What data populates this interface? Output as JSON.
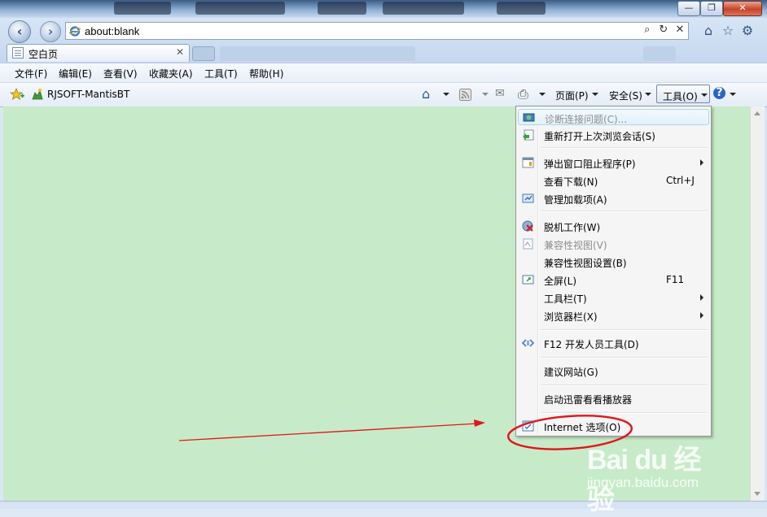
{
  "window": {
    "caption_buttons": [
      "—",
      "❐",
      "✕"
    ]
  },
  "address_bar": {
    "url": "about:blank",
    "search_glyph": "⌕",
    "refresh_glyph": "↻",
    "stop_glyph": "✕"
  },
  "tab": {
    "title": "空白页",
    "close_glyph": "✕"
  },
  "menubar": {
    "items": [
      "文件(F)",
      "编辑(E)",
      "查看(V)",
      "收藏夹(A)",
      "工具(T)",
      "帮助(H)"
    ]
  },
  "favorites_bar": {
    "link": "RJSOFT-MantisBT"
  },
  "command_bar": {
    "page": "页面(P)",
    "safety": "安全(S)",
    "tools": "工具(O)"
  },
  "tools_menu": {
    "items": [
      {
        "label": "诊断连接问题(C)...",
        "disabled": true,
        "highlight": true,
        "icon": "network-icon"
      },
      {
        "label": "重新打开上次浏览会话(S)",
        "icon": "reopen-icon"
      },
      {
        "label": "弹出窗口阻止程序(P)",
        "submenu": true,
        "icon": "popup-blocker-icon"
      },
      {
        "label": "查看下载(N)",
        "shortcut": "Ctrl+J"
      },
      {
        "label": "管理加载项(A)",
        "icon": "addons-icon"
      },
      {
        "label": "脱机工作(W)",
        "icon": "offline-icon"
      },
      {
        "label": "兼容性视图(V)",
        "disabled": true,
        "icon": "compat-view-icon"
      },
      {
        "label": "兼容性视图设置(B)"
      },
      {
        "label": "全屏(L)",
        "shortcut": "F11",
        "icon": "fullscreen-icon"
      },
      {
        "label": "工具栏(T)",
        "submenu": true
      },
      {
        "label": "浏览器栏(X)",
        "submenu": true
      },
      {
        "label": "F12 开发人员工具(D)",
        "icon": "devtools-icon"
      },
      {
        "label": "建议网站(G)"
      },
      {
        "label": "启动迅雷看看播放器"
      },
      {
        "label": "Internet 选项(O)",
        "icon": "internet-options-icon"
      }
    ]
  },
  "watermark": {
    "logo": "Bai du 经验",
    "site": "jingyan.baidu.com"
  },
  "colors": {
    "page_background": "#c7ebc8",
    "annotation": "#e0161b"
  }
}
